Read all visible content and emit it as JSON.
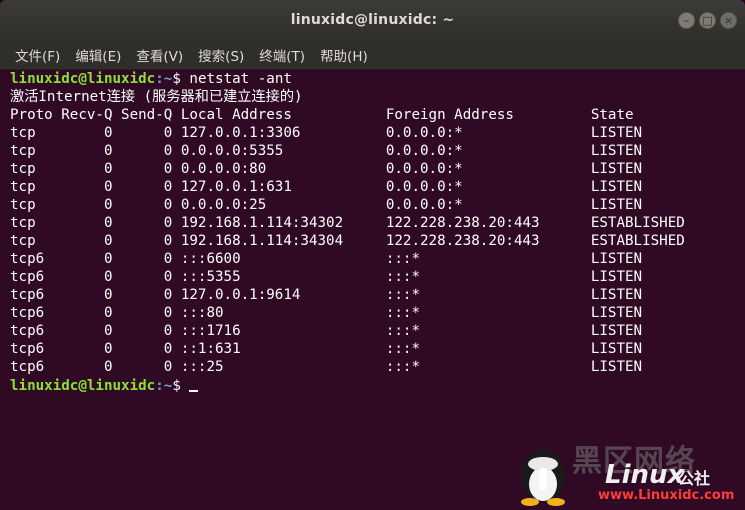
{
  "window": {
    "title": "linuxidc@linuxidc: ~",
    "minimize_glyph": "–",
    "maximize_glyph": "□",
    "close_glyph": "×"
  },
  "menubar": {
    "items": [
      "文件(F)",
      "编辑(E)",
      "查看(V)",
      "搜索(S)",
      "终端(T)",
      "帮助(H)"
    ]
  },
  "terminal": {
    "prompt_user": "linuxidc@linuxidc",
    "prompt_path": ":~",
    "prompt_symbol": "$ ",
    "command": "netstat -ant",
    "lines": [
      "激活Internet连接 (服务器和已建立连接的)",
      "Proto Recv-Q Send-Q Local Address           Foreign Address         State",
      "tcp        0      0 127.0.0.1:3306          0.0.0.0:*               LISTEN",
      "tcp        0      0 0.0.0.0:5355            0.0.0.0:*               LISTEN",
      "tcp        0      0 0.0.0.0:80              0.0.0.0:*               LISTEN",
      "tcp        0      0 127.0.0.1:631           0.0.0.0:*               LISTEN",
      "tcp        0      0 0.0.0.0:25              0.0.0.0:*               LISTEN",
      "tcp        0      0 192.168.1.114:34302     122.228.238.20:443      ESTABLISHED",
      "tcp        0      0 192.168.1.114:34304     122.228.238.20:443      ESTABLISHED",
      "tcp6       0      0 :::6600                 :::*                    LISTEN",
      "tcp6       0      0 :::5355                 :::*                    LISTEN",
      "tcp6       0      0 127.0.0.1:9614          :::*                    LISTEN",
      "tcp6       0      0 :::80                   :::*                    LISTEN",
      "tcp6       0      0 :::1716                 :::*                    LISTEN",
      "tcp6       0      0 ::1:631                 :::*                    LISTEN",
      "tcp6       0      0 :::25                   :::*                    LISTEN"
    ]
  },
  "watermark": {
    "cn_text": "黑区网络",
    "brand": "Linux",
    "brand_suffix": "公社",
    "url": "www.Linuxidc.com"
  }
}
